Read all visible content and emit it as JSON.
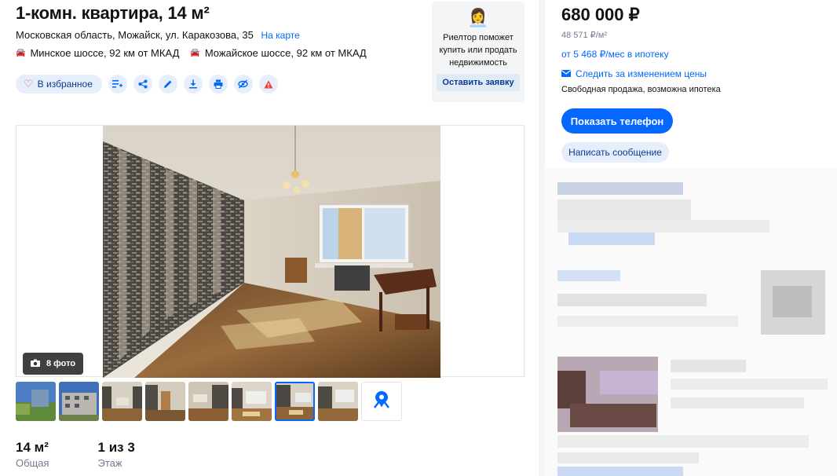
{
  "listing": {
    "title": "1-комн. квартира, 14 м²",
    "address": "Московская область, Можайск, ул. Каракозова, 35",
    "map_link": "На карте",
    "highways": [
      {
        "name": "Минское шоссе, 92 км от МКАД"
      },
      {
        "name": "Можайское шоссе, 92 км от МКАД"
      }
    ]
  },
  "actions": {
    "favorite_label": "В избранное",
    "icons": [
      "compare-icon",
      "share-icon",
      "edit-icon",
      "download-icon",
      "print-icon",
      "hide-icon",
      "report-icon"
    ]
  },
  "realtor": {
    "emoji": "👩‍💼",
    "text": "Риелтор поможет купить или продать недвижимость",
    "button": "Оставить заявку"
  },
  "gallery": {
    "photo_count": "8 фото",
    "thumb_count": 8,
    "active_thumb": 7
  },
  "facts": [
    {
      "value": "14 м²",
      "label": "Общая"
    },
    {
      "value": "1 из 3",
      "label": "Этаж"
    }
  ],
  "sidebar": {
    "price": "680 000 ₽",
    "price_per_meter": "48 571 ₽/м²",
    "mortgage": "от 5 468 ₽/мес в ипотеку",
    "track_price": "Следить за изменением цены",
    "sale_type": "Свободная продажа, возможна ипотека",
    "phone_button": "Показать телефон",
    "message_button": "Написать сообщение"
  },
  "colors": {
    "accent": "#0468ff",
    "soft_button": "#e6eefb",
    "muted_text": "#737a8e"
  }
}
